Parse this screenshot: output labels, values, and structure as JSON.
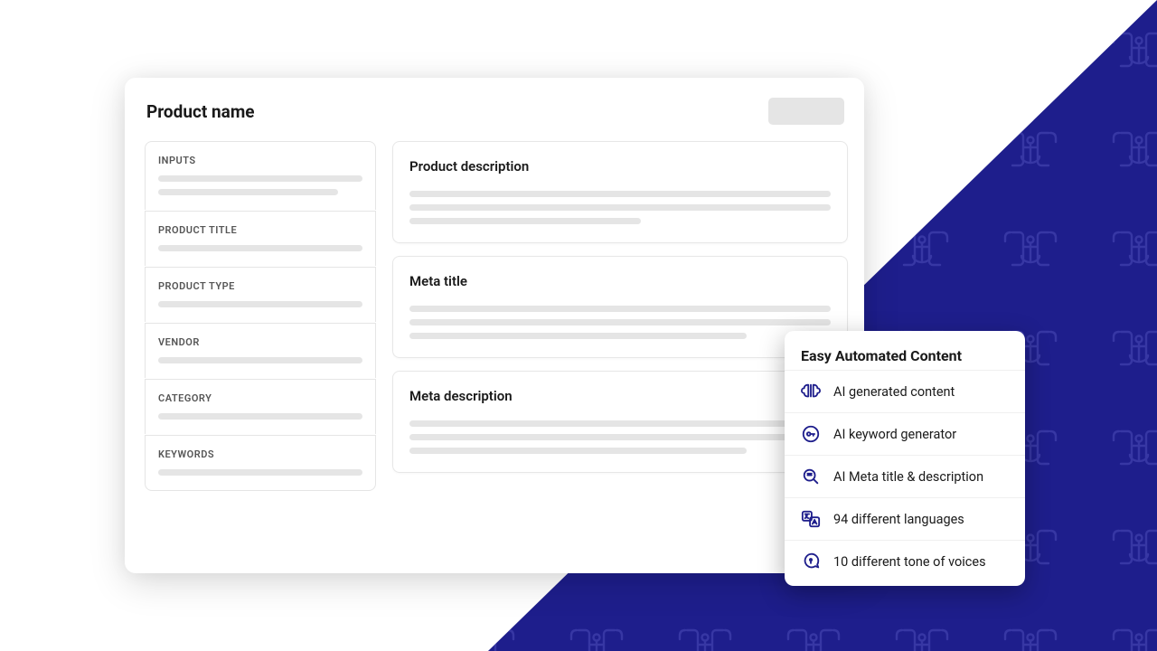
{
  "colors": {
    "brand_navy": "#1e1e8c",
    "brand_icon": "#4a4ab0"
  },
  "page": {
    "title": "Product name"
  },
  "left_sections": [
    {
      "label": "INPUTS",
      "lines": 2
    },
    {
      "label": "PRODUCT TITLE",
      "lines": 1
    },
    {
      "label": "PRODUCT TYPE",
      "lines": 1
    },
    {
      "label": "VENDOR",
      "lines": 1
    },
    {
      "label": "CATEGORY",
      "lines": 1
    },
    {
      "label": "KEYWORDS",
      "lines": 1
    }
  ],
  "right_cards": [
    {
      "title": "Product description"
    },
    {
      "title": "Meta title"
    },
    {
      "title": "Meta description"
    }
  ],
  "popup": {
    "title": "Easy Automated Content",
    "items": [
      {
        "icon": "ai-brain",
        "label": "AI generated content"
      },
      {
        "icon": "key",
        "label": "AI keyword generator"
      },
      {
        "icon": "search",
        "label": "AI Meta title & description"
      },
      {
        "icon": "translate",
        "label": "94 different languages"
      },
      {
        "icon": "chat",
        "label": "10 different tone of voices"
      }
    ]
  }
}
